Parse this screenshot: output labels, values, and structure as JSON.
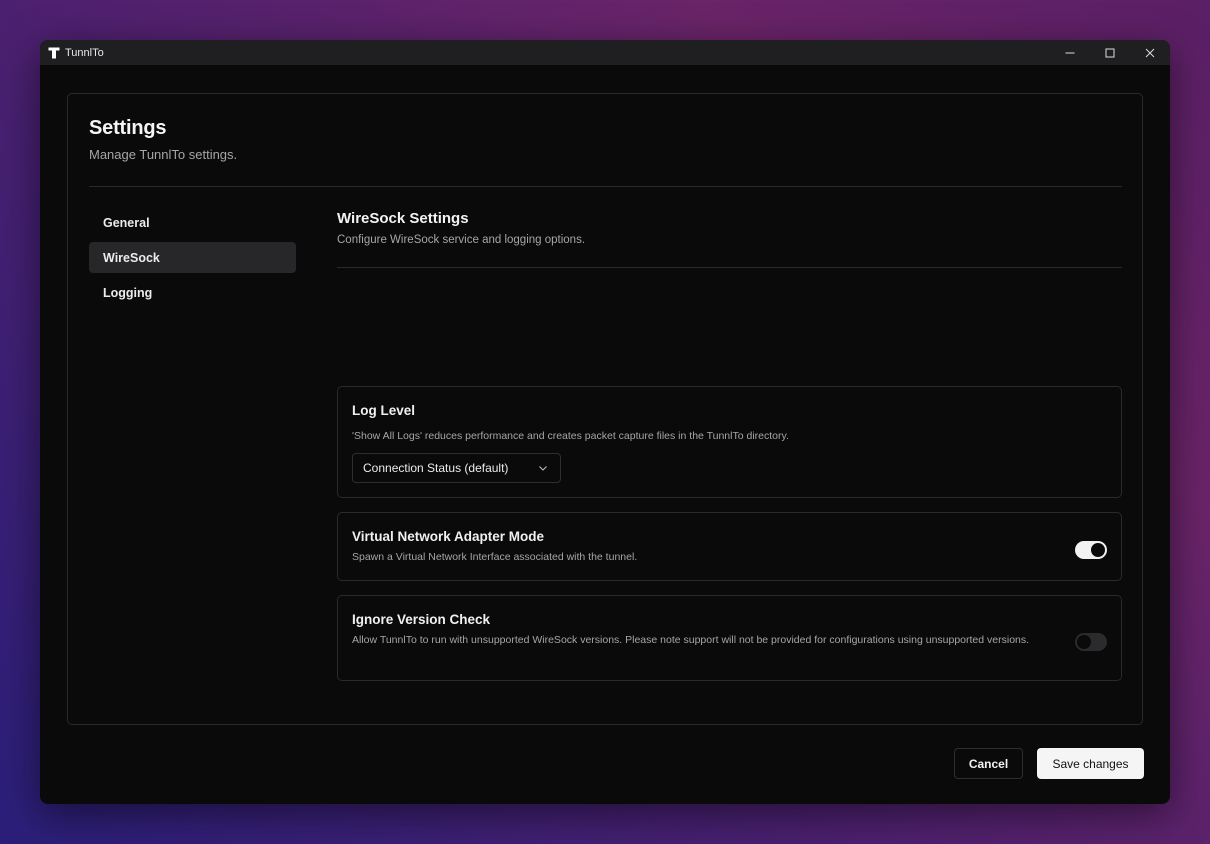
{
  "window": {
    "title": "TunnlTo"
  },
  "page": {
    "title": "Settings",
    "subtitle": "Manage TunnlTo settings."
  },
  "nav": {
    "items": [
      {
        "label": "General",
        "active": false
      },
      {
        "label": "WireSock",
        "active": true
      },
      {
        "label": "Logging",
        "active": false
      }
    ]
  },
  "section": {
    "title": "WireSock Settings",
    "description": "Configure WireSock service and logging options."
  },
  "log_level": {
    "title": "Log Level",
    "description": "'Show All Logs' reduces performance and creates packet capture files in the TunnlTo directory.",
    "selected": "Connection Status (default)"
  },
  "adapter_mode": {
    "title": "Virtual Network Adapter Mode",
    "description": "Spawn a Virtual Network Interface associated with the tunnel.",
    "enabled": true
  },
  "version_check": {
    "title": "Ignore Version Check",
    "description": "Allow TunnlTo to run with unsupported WireSock versions. Please note support will not be provided for configurations using unsupported versions.",
    "enabled": false
  },
  "footer": {
    "cancel_label": "Cancel",
    "save_label": "Save changes"
  },
  "colors": {
    "window_bg": "#0a0a0b",
    "titlebar_bg": "#1f1f21",
    "border": "#2a2a2d",
    "active_nav_bg": "#27272a",
    "muted_text": "#a6a6a8",
    "primary_button_bg": "#f5f5f5"
  },
  "icons": {
    "app": "tunnlto-logo-icon",
    "minimize": "minimize-icon",
    "maximize": "maximize-icon",
    "close": "close-icon",
    "dropdown": "chevron-down-icon"
  }
}
